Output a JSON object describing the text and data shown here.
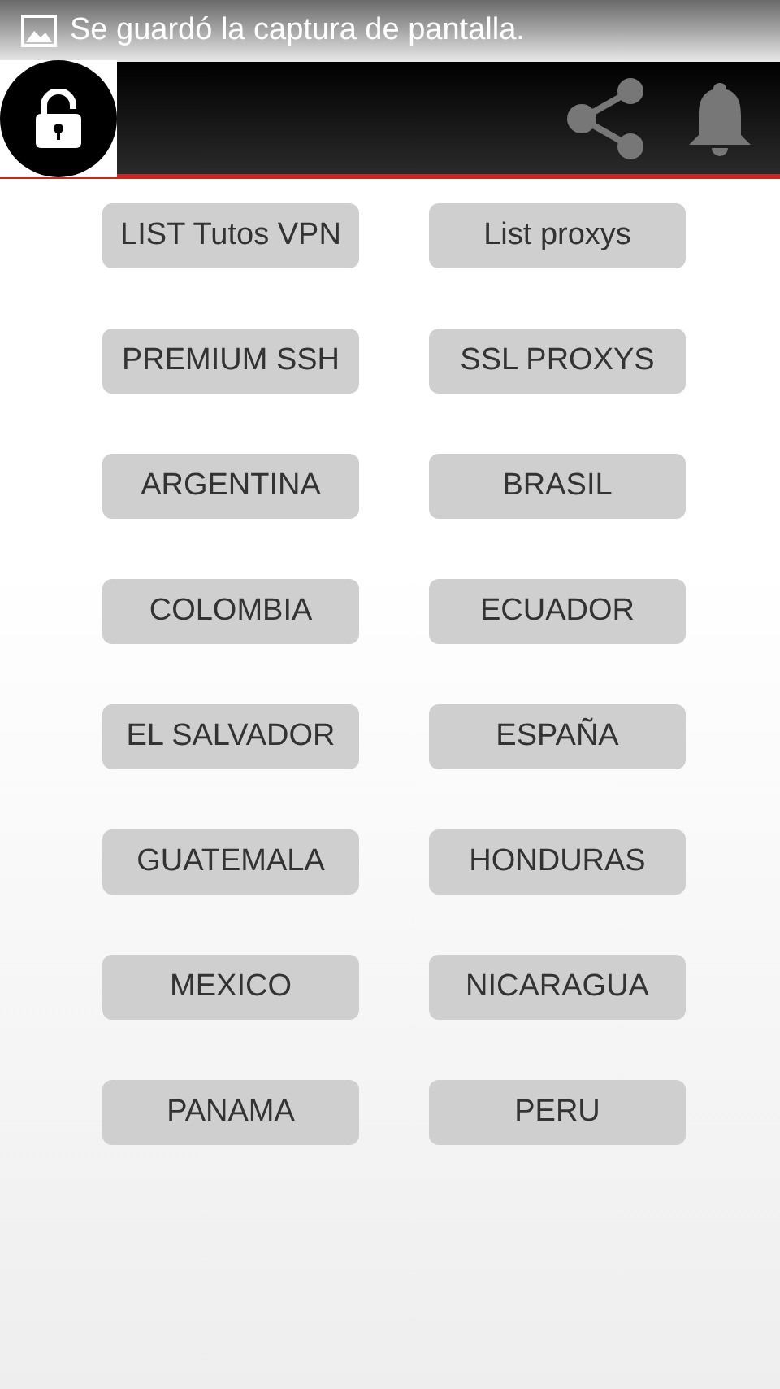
{
  "notification": {
    "text": "Se guardó la captura de pantalla."
  },
  "buttons": [
    {
      "label": "LIST Tutos VPN"
    },
    {
      "label": "List proxys"
    },
    {
      "label": "PREMIUM SSH"
    },
    {
      "label": "SSL PROXYS"
    },
    {
      "label": "ARGENTINA"
    },
    {
      "label": "BRASIL"
    },
    {
      "label": "COLOMBIA"
    },
    {
      "label": "ECUADOR"
    },
    {
      "label": "EL SALVADOR"
    },
    {
      "label": "ESPAÑA"
    },
    {
      "label": "GUATEMALA"
    },
    {
      "label": "HONDURAS"
    },
    {
      "label": "MEXICO"
    },
    {
      "label": "NICARAGUA"
    },
    {
      "label": "PANAMA"
    },
    {
      "label": "PERU"
    }
  ]
}
